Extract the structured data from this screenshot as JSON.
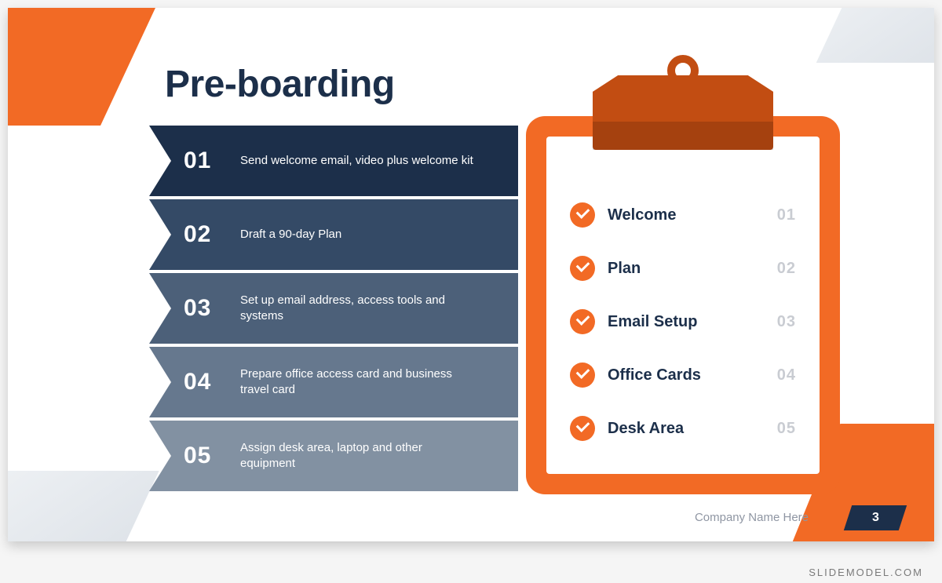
{
  "title": "Pre-boarding",
  "bars": [
    {
      "num": "01",
      "text": "Send welcome email, video plus welcome kit",
      "color": "#1c2f4a"
    },
    {
      "num": "02",
      "text": "Draft a 90-day Plan",
      "color": "#344a66"
    },
    {
      "num": "03",
      "text": "Set up email address, access tools and systems",
      "color": "#4c6079"
    },
    {
      "num": "04",
      "text": "Prepare office access card and business travel card",
      "color": "#66788e"
    },
    {
      "num": "05",
      "text": "Assign desk area, laptop and other equipment",
      "color": "#8291a2"
    }
  ],
  "checklist": [
    {
      "label": "Welcome",
      "num": "01"
    },
    {
      "label": "Plan",
      "num": "02"
    },
    {
      "label": "Email Setup",
      "num": "03"
    },
    {
      "label": "Office Cards",
      "num": "04"
    },
    {
      "label": "Desk Area",
      "num": "05"
    }
  ],
  "footer": {
    "company": "Company Name Here",
    "page": "3"
  },
  "brand": "SLIDEMODEL.COM"
}
